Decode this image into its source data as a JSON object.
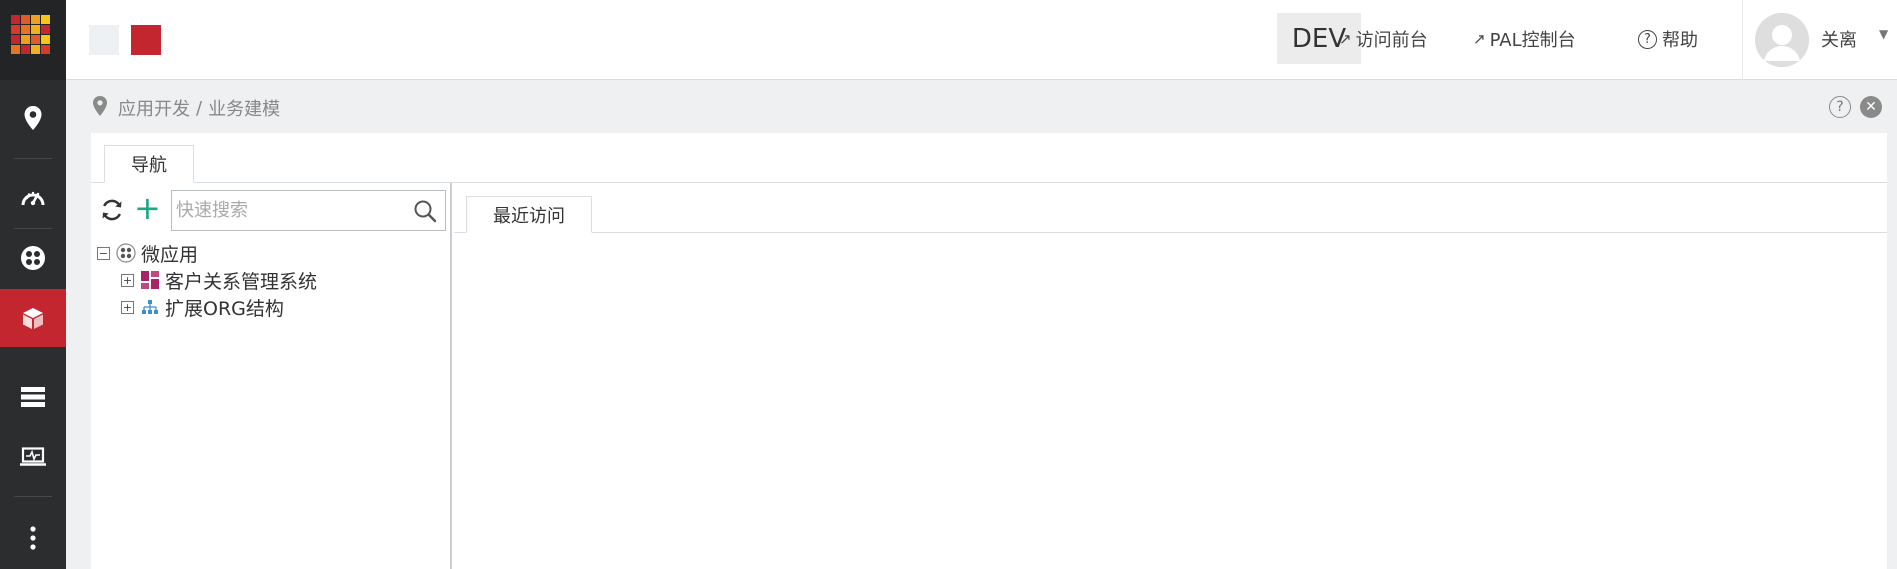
{
  "brand": {
    "logo_colors": [
      "#c3262e",
      "#e05b2a",
      "#f0a020",
      "#f5c518",
      "#d83a2a",
      "#e8741f",
      "#f2b11c",
      "#c3262e",
      "#c3262e",
      "#f0a020",
      "#e05b2a",
      "#f5c518",
      "#e8741f",
      "#c3262e",
      "#f2b11c",
      "#d83a2a"
    ],
    "swatch_colors": [
      "#eef1f4",
      "#c3262e"
    ]
  },
  "header": {
    "env_label": "DEV",
    "links": [
      {
        "label": "访问前台",
        "icon": "external-arrow-icon"
      },
      {
        "label": "PAL控制台",
        "icon": "external-arrow-icon"
      },
      {
        "label": "帮助",
        "icon": "help-icon"
      }
    ],
    "user": {
      "name": "关离"
    }
  },
  "sidebar": {
    "items": [
      {
        "name": "location",
        "icon": "map-pin-icon",
        "active": false
      },
      {
        "name": "dashboard",
        "icon": "speedometer-icon",
        "active": false
      },
      {
        "name": "apps",
        "icon": "apps-grid-icon",
        "active": false
      },
      {
        "name": "modeling",
        "icon": "cube-icon",
        "active": true
      },
      {
        "name": "data",
        "icon": "layers-icon",
        "active": false
      },
      {
        "name": "monitor",
        "icon": "monitor-icon",
        "active": false
      },
      {
        "name": "more",
        "icon": "more-vertical-icon",
        "active": false
      }
    ],
    "accent": "#c3262e"
  },
  "breadcrumb": {
    "items": [
      "应用开发",
      "业务建模"
    ],
    "separator": "/"
  },
  "panel": {
    "tab": "导航",
    "search": {
      "placeholder": "快速搜索",
      "value": ""
    },
    "tree": {
      "root": {
        "label": "微应用",
        "expanded": true
      },
      "children": [
        {
          "label": "客户关系管理系统",
          "icon": "dashboard-tiles-icon"
        },
        {
          "label": "扩展ORG结构",
          "icon": "org-chart-icon"
        }
      ]
    },
    "content_tab": "最近访问"
  }
}
